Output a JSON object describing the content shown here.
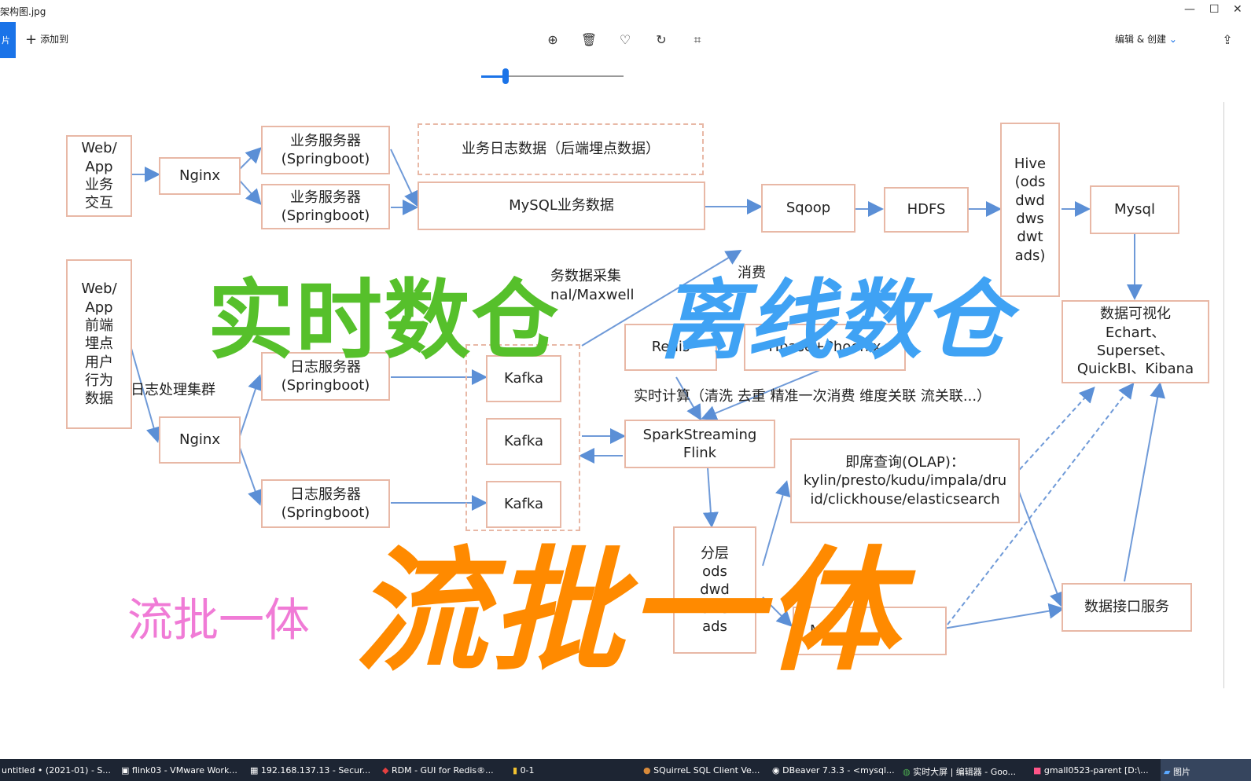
{
  "window": {
    "title": "架构图.jpg"
  },
  "toolbar": {
    "pic_label": "片",
    "add_label": "添加到",
    "edit_label": "编辑 & 创建",
    "zoom_icon": "⊕",
    "delete_icon": "🗑",
    "favorite_icon": "♡",
    "rotate_icon": "↻",
    "crop_icon": "⌗",
    "share_icon": "⇪"
  },
  "zoom": {
    "level": 0.17
  },
  "diagram": {
    "web_app_interact": "Web/\nApp\n业务\n交互",
    "nginx_top": "Nginx",
    "biz_server_1": "业务服务器\n(Springboot)",
    "biz_server_2": "业务服务器\n(Springboot)",
    "biz_log_data": "业务日志数据（后端埋点数据）",
    "mysql_biz": "MySQL业务数据",
    "sqoop": "Sqoop",
    "hdfs": "HDFS",
    "hive": "Hive\n(ods\ndwd\ndws\ndwt\nads)",
    "mysql": "Mysql",
    "web_app_front": "Web/\nApp\n前端\n埋点\n用户\n行为\n数据",
    "log_cluster": "日志处理集群",
    "nginx_bottom": "Nginx",
    "log_server_1": "日志服务器\n(Springboot)",
    "log_server_2": "日志服务器\n(Springboot)",
    "biz_collect": "务数据采集\nnal/Maxwell",
    "kafka_1": "Kafka",
    "kafka_2": "Kafka",
    "kafka_3": "Kafka",
    "redis": "Redis",
    "hbase": "Hbase+Phoenix",
    "consume": "消费",
    "realtime_calc": "实时计算（清洗 去重 精准一次消费 维度关联 流关联...）",
    "spark_flink": "SparkStreaming\nFlink",
    "olap": "即席查询(OLAP)：\nkylin/presto/kudu/impala/dru\nid/clickhouse/elasticsearch",
    "layers": "分层\nods\ndwd\ndws\nads",
    "m_box": "M",
    "viz": "数据可视化\nEchart、\nSuperset、\nQuickBI、Kibana",
    "api_service": "数据接口服务"
  },
  "overlay": {
    "realtime": "实时数仓",
    "offline": "离线数仓",
    "unified_big": "流批一体",
    "unified_small": "流批一体"
  },
  "taskbar": {
    "items": [
      "untitled • (2021-01) - S...",
      "flink03 - VMware Work...",
      "192.168.137.13 - Secur...",
      "RDM - GUI for Redis®...",
      "0-1",
      "SQuirreL SQL Client Ve...",
      "DBeaver 7.3.3 - <mysql...",
      "实时大屏 | 编辑器 - Goo...",
      "gmall0523-parent [D:\\...",
      "图片"
    ]
  },
  "colors": {
    "green": "#56c02b",
    "blue": "#3fa2f4",
    "orange": "#ff8a00",
    "pink": "#f07bd6",
    "box_border": "#e8b8a6",
    "arrow": "#5b8fd6"
  }
}
